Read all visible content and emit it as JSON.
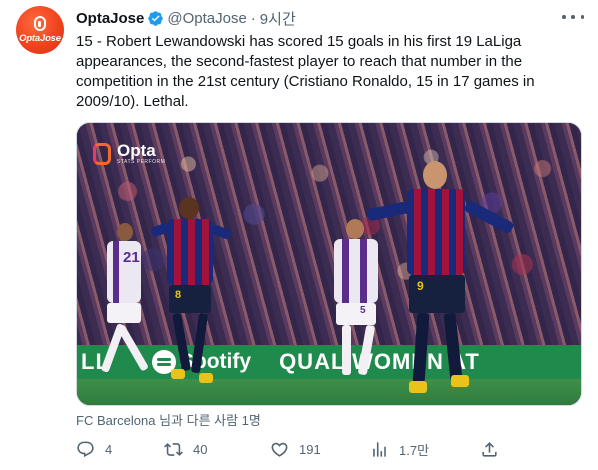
{
  "account": {
    "name": "OptaJose",
    "handle": "@OptaJose",
    "separator": "·",
    "time": "9시간",
    "avatar_text": "OptaJose"
  },
  "tweet": {
    "text": "15 - Robert Lewandowski has scored 15 goals in his first 19 LaLiga appearances, the second-fastest player to reach that number in the competition in the 21st century (Cristiano Ronaldo, 15 in 17 games in 2009/10). Lethal."
  },
  "media": {
    "watermark_text": "Opta",
    "watermark_subtext": "STATS PERFORM",
    "board_left": "LL",
    "board_sponsor": "Spotify",
    "board_right": "QUAL WOMEN AT",
    "jersey_numbers": [
      "8",
      "9",
      "21",
      "5"
    ]
  },
  "tagged": "FC Barcelona 님과 다른 사람 1명",
  "actions": {
    "reply_count": "4",
    "retweet_count": "40",
    "like_count": "191",
    "views_count": "1.7만"
  },
  "icons": [
    "verified-badge-icon",
    "more-icon",
    "reply-icon",
    "retweet-icon",
    "like-icon",
    "views-icon",
    "share-icon"
  ],
  "colors": {
    "text": "#0f1419",
    "secondary": "#536471",
    "verified": "#1d9bf0",
    "brand": "#f0421f"
  }
}
